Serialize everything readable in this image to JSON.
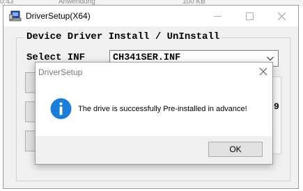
{
  "background_window": {
    "left_text": "0:43",
    "middle_text": "Anwendung",
    "right_text": "100 KB"
  },
  "main_window": {
    "title": "DriverSetup(X64)",
    "group_title": "Device Driver Install / UnInstall",
    "select_label": "Select INF",
    "inf_value": "CH341SER.INF",
    "partial_right_text": "9",
    "icons": {
      "app": "driver-setup-app-icon",
      "minimize": "minimize-icon",
      "maximize": "maximize-icon",
      "close": "close-icon",
      "dropdown": "chevron-down-icon"
    }
  },
  "dialog": {
    "title": "DriverSetup",
    "message": "The drive is successfully Pre-installed in advance!",
    "ok_label": "OK",
    "icon": "info-icon",
    "close_icon": "close-icon"
  },
  "colors": {
    "info_blue": "#1c7dd6",
    "window_bg": "#f0f0f0",
    "button_bg": "#e1e1e1"
  }
}
